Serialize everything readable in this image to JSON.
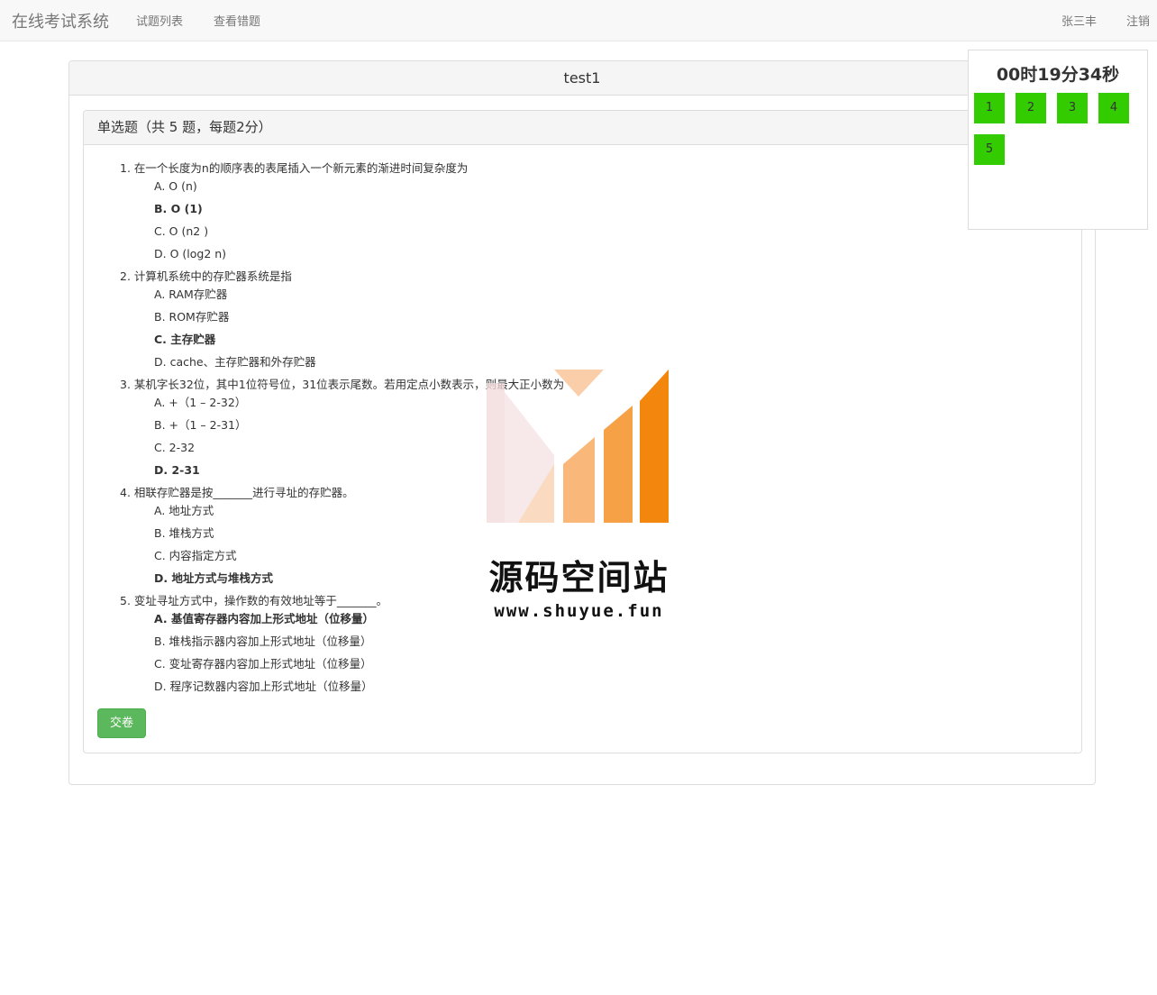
{
  "navbar": {
    "brand": "在线考试系统",
    "links": [
      "试题列表",
      "查看错题"
    ],
    "user": "张三丰",
    "logout": "注销"
  },
  "exam": {
    "title": "test1",
    "section_heading": "单选题（共 5 题，每题2分）",
    "questions": [
      {
        "title": "1. 在一个长度为n的顺序表的表尾插入一个新元素的渐进时间复杂度为",
        "options": [
          "A. O (n)",
          "B. O (1)",
          "C. O (n2 )",
          "D. O (log2 n)"
        ],
        "selected": 1
      },
      {
        "title": "2. 计算机系统中的存贮器系统是指",
        "options": [
          "A. RAM存贮器",
          "B. ROM存贮器",
          "C. 主存贮器",
          "D. cache、主存贮器和外存贮器"
        ],
        "selected": 2
      },
      {
        "title": "3. 某机字长32位，其中1位符号位，31位表示尾数。若用定点小数表示，则最大正小数为",
        "options": [
          "A. +（1 – 2-32）",
          "B. +（1 – 2-31）",
          "C. 2-32",
          "D. 2-31"
        ],
        "selected": 3
      },
      {
        "title": "4. 相联存贮器是按_______进行寻址的存贮器。",
        "options": [
          "A. 地址方式",
          "B. 堆栈方式",
          "C. 内容指定方式",
          "D. 地址方式与堆栈方式"
        ],
        "selected": 3
      },
      {
        "title": "5. 变址寻址方式中，操作数的有效地址等于_______。",
        "options": [
          "A. 基值寄存器内容加上形式地址（位移量）",
          "B. 堆栈指示器内容加上形式地址（位移量）",
          "C. 变址寄存器内容加上形式地址（位移量）",
          "D. 程序记数器内容加上形式地址（位移量）"
        ],
        "selected": 0
      }
    ],
    "submit_label": "交卷"
  },
  "timer": {
    "text": "00时19分34秒",
    "question_buttons": [
      "1",
      "2",
      "3",
      "4",
      "5"
    ],
    "answered_color": "#33cc00"
  },
  "watermark": {
    "title": "源码空间站",
    "url": "www.shuyue.fun"
  }
}
